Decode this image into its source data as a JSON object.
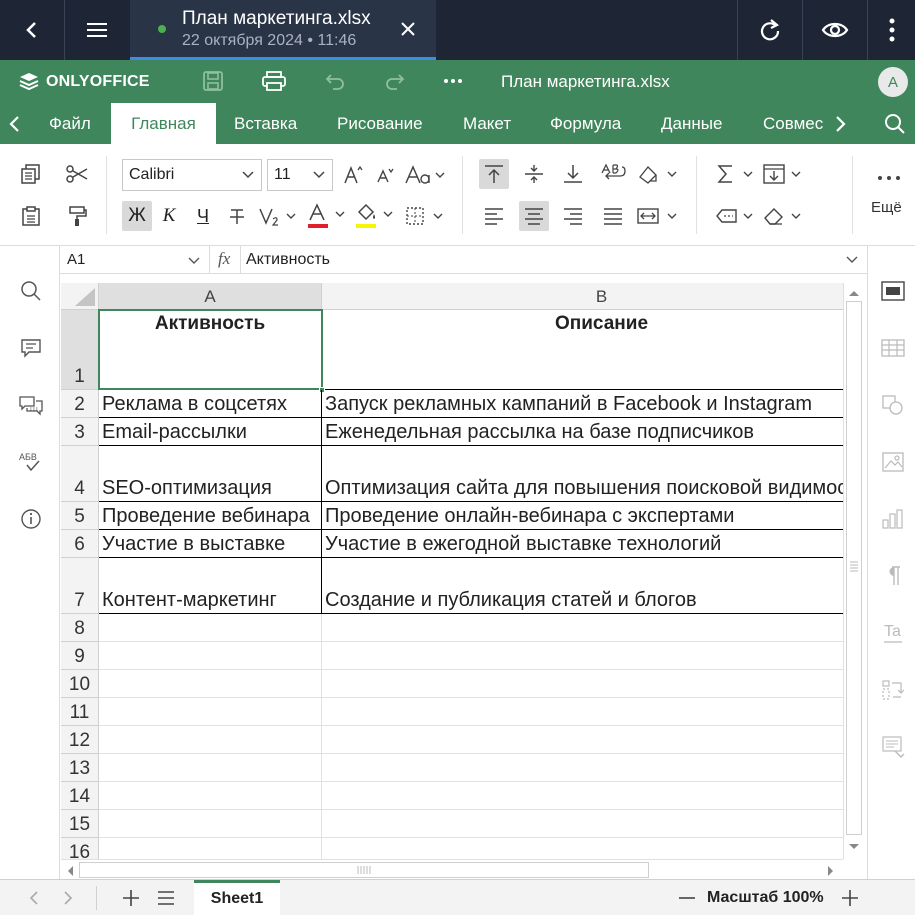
{
  "topbar": {
    "tab_title": "План маркетинга.xlsx",
    "tab_subtitle": "22 октября 2024 • 11:46",
    "status_dot_color": "#4caf50",
    "icons": [
      "back-icon",
      "hamburger-menu-icon",
      "close-icon",
      "refresh-icon",
      "eye-icon",
      "more-vertical-icon"
    ]
  },
  "app": {
    "brand": "ONLYOFFICE",
    "doc_title": "План маркетинга.xlsx",
    "avatar_initial": "A",
    "accent_color": "#40865c",
    "toolbar_icons": [
      "save-icon",
      "print-icon",
      "undo-icon",
      "redo-icon",
      "more-horizontal-icon"
    ]
  },
  "menu": {
    "tabs": [
      "Файл",
      "Главная",
      "Вставка",
      "Рисование",
      "Макет",
      "Формула",
      "Данные",
      "Совмес"
    ],
    "active": "Главная"
  },
  "ribbon": {
    "font_name": "Calibri",
    "font_size": "11",
    "more_label": "Ещё",
    "bold_glyph": "Ж",
    "italic_glyph": "К",
    "underline_glyph": "Ч",
    "font_color": "#e0202a",
    "fill_color": "#f6f600"
  },
  "formula_bar": {
    "cell_ref": "A1",
    "fx_label": "fx",
    "value": "Активность"
  },
  "sheet": {
    "columns": [
      "A",
      "B"
    ],
    "rows": [
      {
        "num": "1",
        "a": "Активность",
        "b": "Описание",
        "header": true
      },
      {
        "num": "2",
        "a": "Реклама в соцсетях",
        "b": "Запуск рекламных кампаний в Facebook и Instagram"
      },
      {
        "num": "3",
        "a": "Email-рассылки",
        "b": "Еженедельная рассылка на базе подписчиков"
      },
      {
        "num": "4",
        "a": "SEO-оптимизация",
        "b": "Оптимизация сайта для повышения поисковой видимости"
      },
      {
        "num": "5",
        "a": "Проведение вебинара",
        "b": "Проведение онлайн-вебинара с экспертами"
      },
      {
        "num": "6",
        "a": "Участие в выставке",
        "b": "Участие в ежегодной выставке технологий"
      },
      {
        "num": "7",
        "a": "Контент-маркетинг",
        "b": "Создание и публикация статей и блогов"
      },
      {
        "num": "8",
        "a": "",
        "b": ""
      },
      {
        "num": "9",
        "a": "",
        "b": ""
      },
      {
        "num": "10",
        "a": "",
        "b": ""
      },
      {
        "num": "11",
        "a": "",
        "b": ""
      },
      {
        "num": "12",
        "a": "",
        "b": ""
      },
      {
        "num": "13",
        "a": "",
        "b": ""
      },
      {
        "num": "14",
        "a": "",
        "b": ""
      },
      {
        "num": "15",
        "a": "",
        "b": ""
      },
      {
        "num": "16",
        "a": "",
        "b": ""
      }
    ],
    "selected_cell": "A1"
  },
  "status": {
    "sheet_tab": "Sheet1",
    "zoom_label": "Масштаб 100%"
  }
}
